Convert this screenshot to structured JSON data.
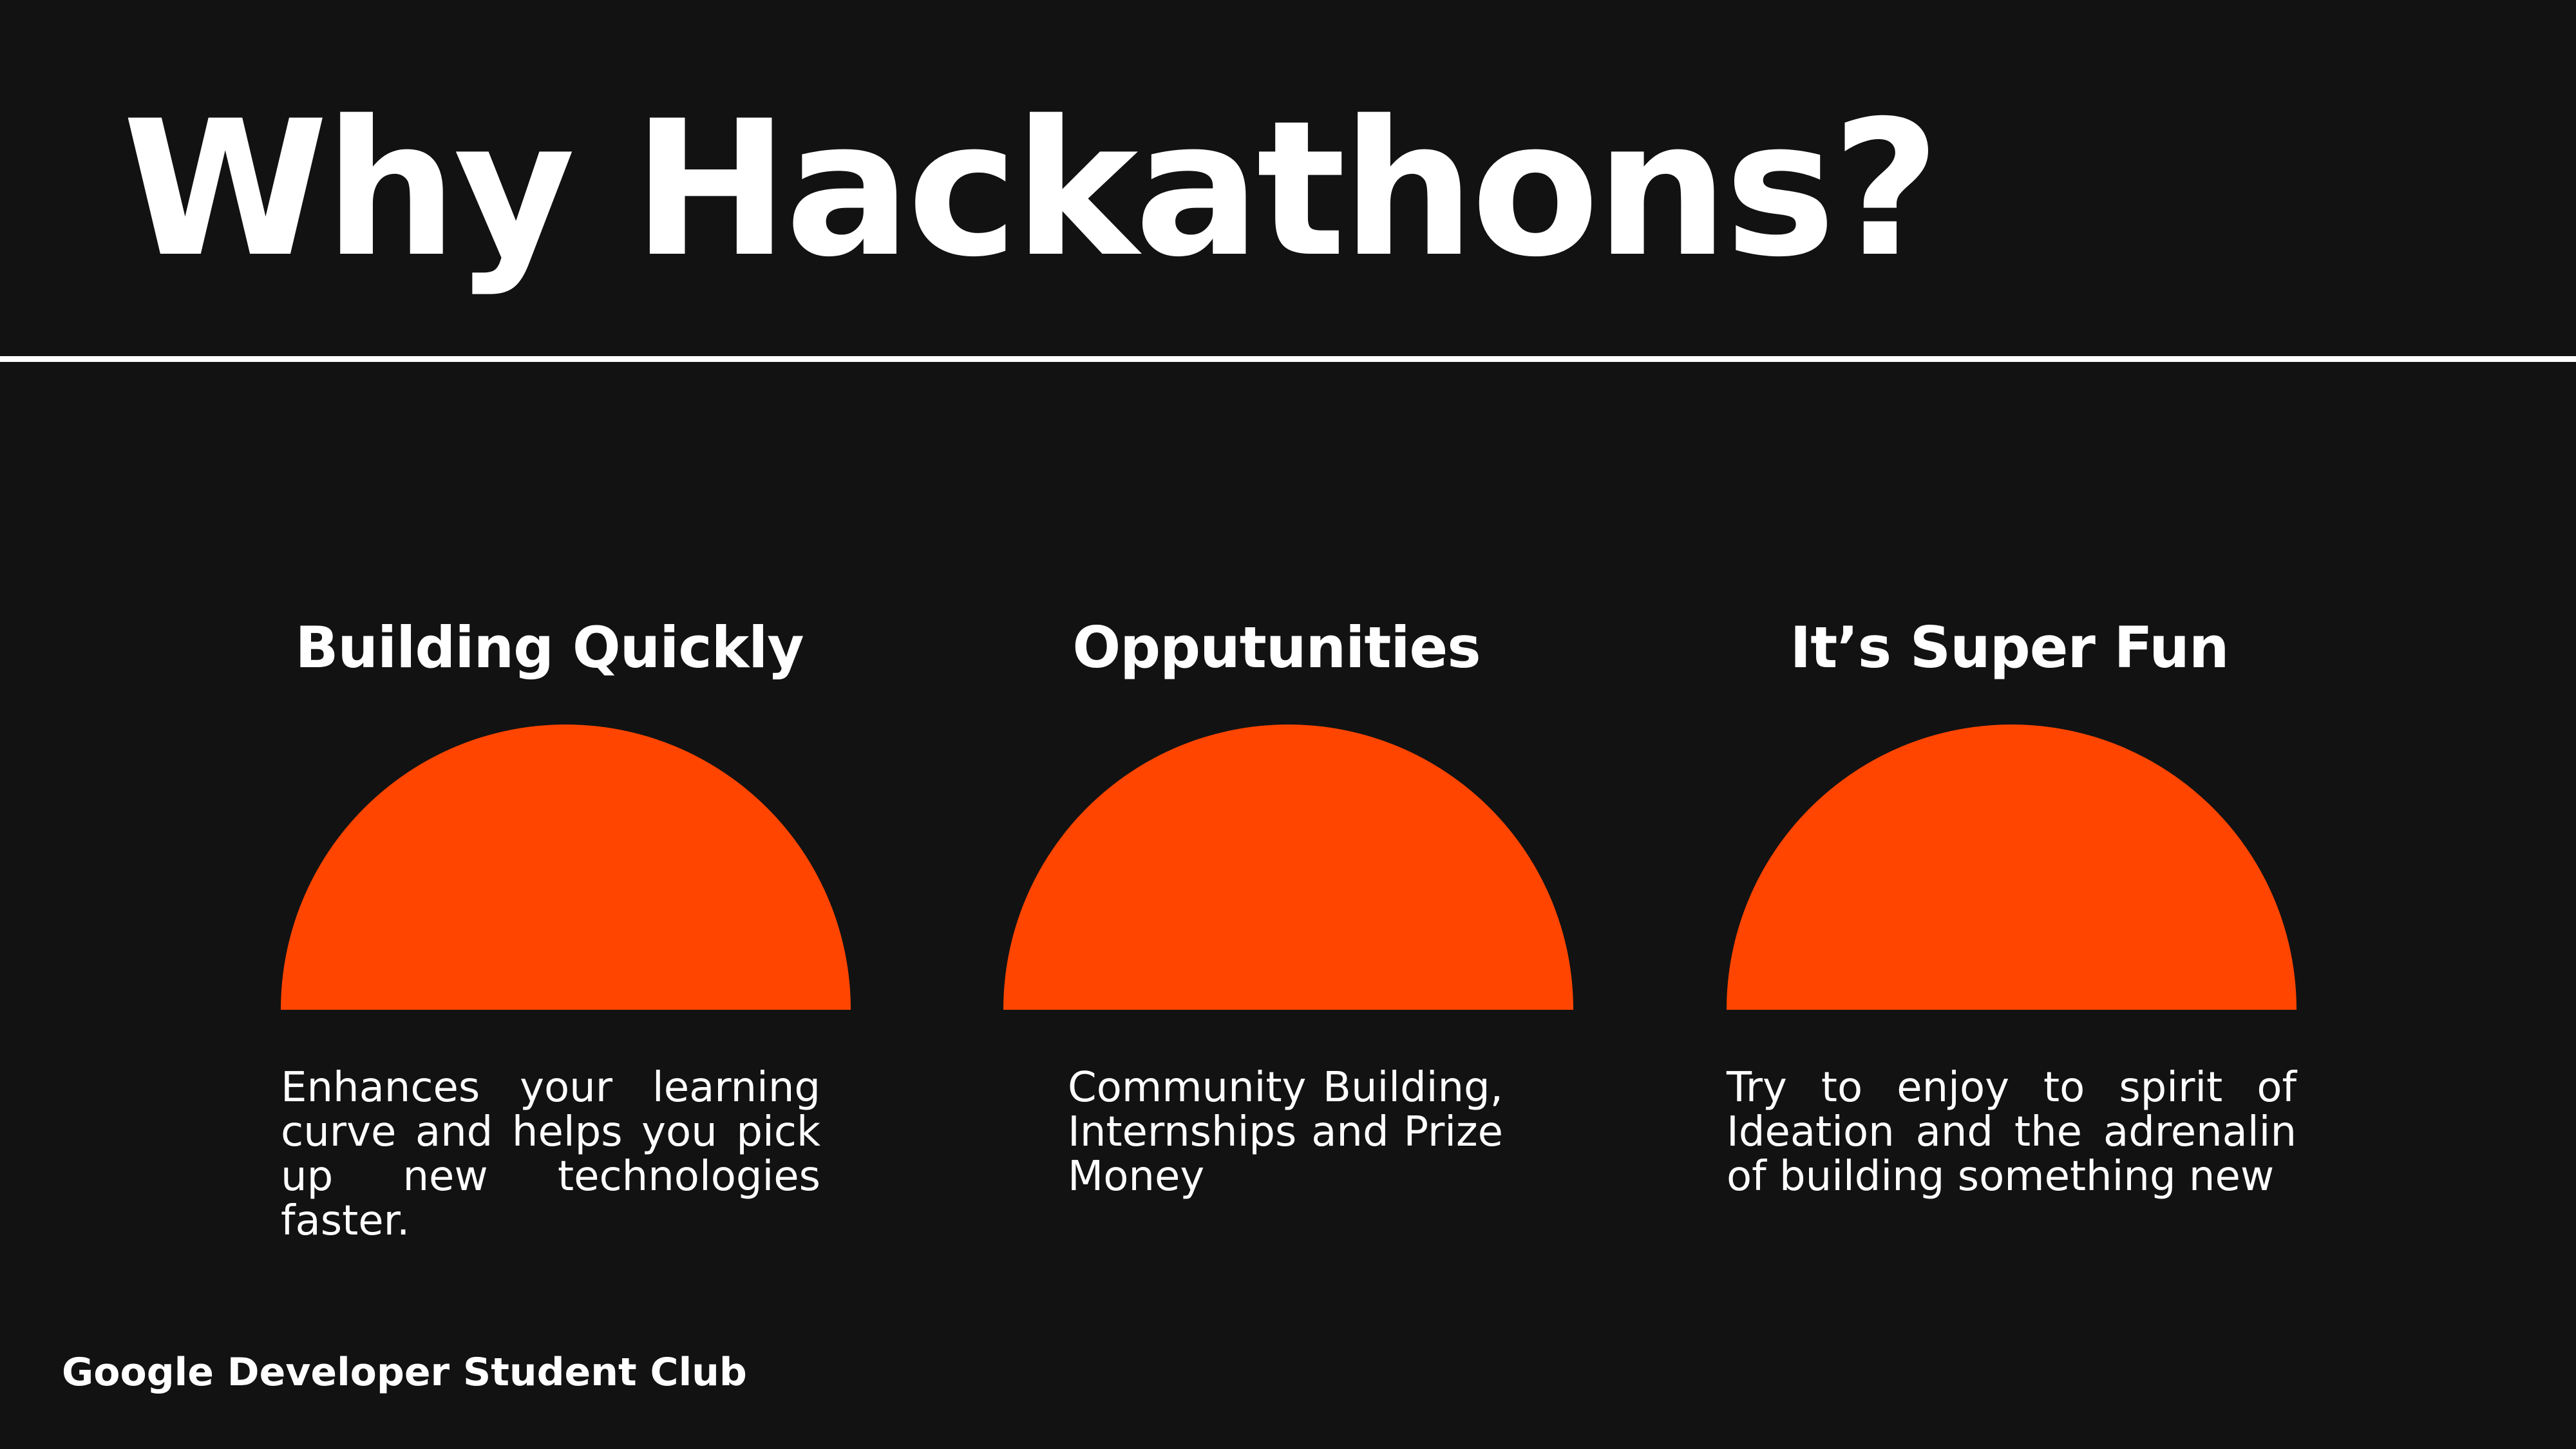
{
  "slide": {
    "title": "Why Hackathons?",
    "footer": "Google Developer Student Club"
  },
  "theme": {
    "background": "#121212",
    "text": "#ffffff",
    "accent": "#ff4500"
  },
  "columns": [
    {
      "heading": "Building Quickly",
      "description": "Enhances your learning curve and helps you pick up new technologies faster."
    },
    {
      "heading": "Opputunities",
      "description": "Community Building, Internships and Prize Money"
    },
    {
      "heading": "It’s Super Fun",
      "description": "Try to enjoy to spirit of Ideation and the adrenalin of building something new"
    }
  ]
}
